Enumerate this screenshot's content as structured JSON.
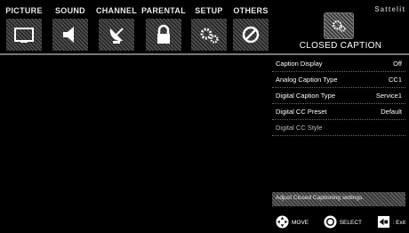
{
  "tabs": [
    {
      "label": "PICTURE",
      "icon": "tv-icon"
    },
    {
      "label": "SOUND",
      "icon": "speaker-icon"
    },
    {
      "label": "CHANNEL",
      "icon": "satellite-dish-icon"
    },
    {
      "label": "PARENTAL",
      "icon": "lock-icon"
    },
    {
      "label": "SETUP",
      "icon": "gears-icon"
    },
    {
      "label": "OTHERS",
      "icon": "no-entry-icon"
    }
  ],
  "brand": "Sattelit",
  "panel": {
    "title": "CLOSED CAPTION",
    "icon": "closed-caption-icon"
  },
  "menu": [
    {
      "label": "Caption Display",
      "value": "Off"
    },
    {
      "label": "Analog Caption Type",
      "value": "CC1"
    },
    {
      "label": "Digital Caption Type",
      "value": "Service1"
    },
    {
      "label": "Digital CC Preset",
      "value": "Default"
    },
    {
      "label": "Digital CC Style",
      "value": ""
    }
  ],
  "help_text": "Adjust Closed Captioning settings.",
  "legend": {
    "move": "MOVE",
    "select": "SELECT",
    "exit": ": Exit"
  }
}
